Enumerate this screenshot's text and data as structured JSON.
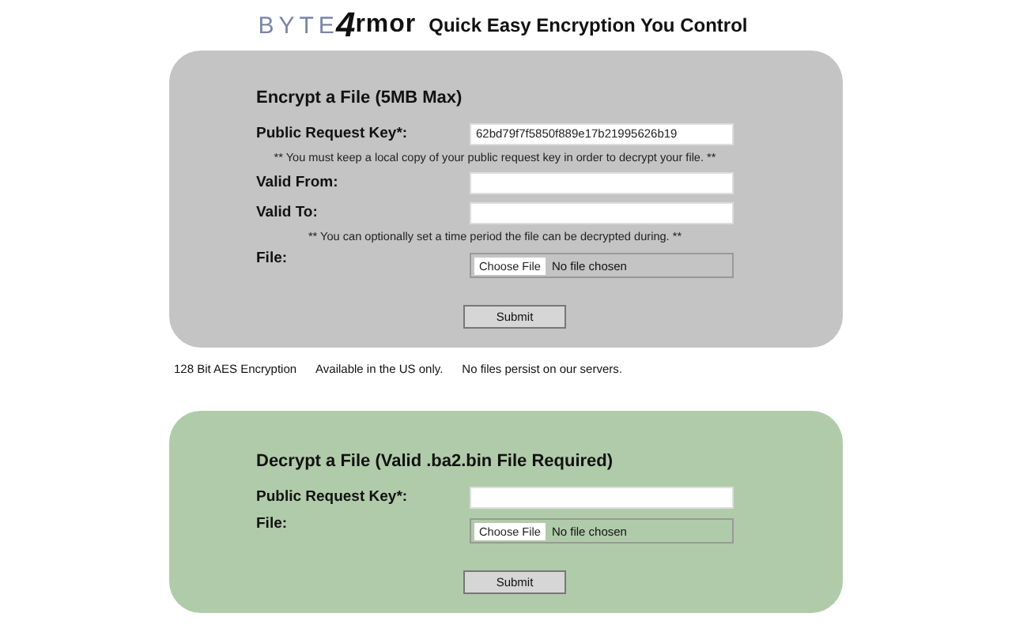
{
  "header": {
    "logo_left": "BYTE",
    "logo_mark": "4",
    "logo_right": "rmor",
    "tagline": "Quick Easy Encryption You Control"
  },
  "panels": [
    {
      "kind": "encrypt",
      "title": "Encrypt a File (5MB Max)",
      "rows": [
        {
          "kind": "field",
          "label": "Public Request Key*:",
          "value": "62bd79f7f5850f889e17b21995626b19"
        },
        {
          "kind": "note",
          "text": "** You must keep a local copy of your public request key in order to decrypt your file. **"
        },
        {
          "kind": "field",
          "label": "Valid From:"
        },
        {
          "kind": "field",
          "label": "Valid To:"
        },
        {
          "kind": "note",
          "text": "** You can optionally set a time period the file can be decrypted during. **"
        },
        {
          "kind": "file",
          "label": "File:",
          "button": "Choose File",
          "status": "No file chosen"
        }
      ],
      "submit": "Submit"
    },
    {
      "kind": "decrypt",
      "title": "Decrypt a File (Valid .ba2.bin File Required)",
      "rows": [
        {
          "kind": "field",
          "label": "Public Request Key*:"
        },
        {
          "kind": "file",
          "label": "File:",
          "button": "Choose File",
          "status": "No file chosen"
        }
      ],
      "submit": "Submit"
    }
  ],
  "footer": [
    "128 Bit AES Encryption",
    "Available in the US only.",
    "No files persist on our servers."
  ]
}
